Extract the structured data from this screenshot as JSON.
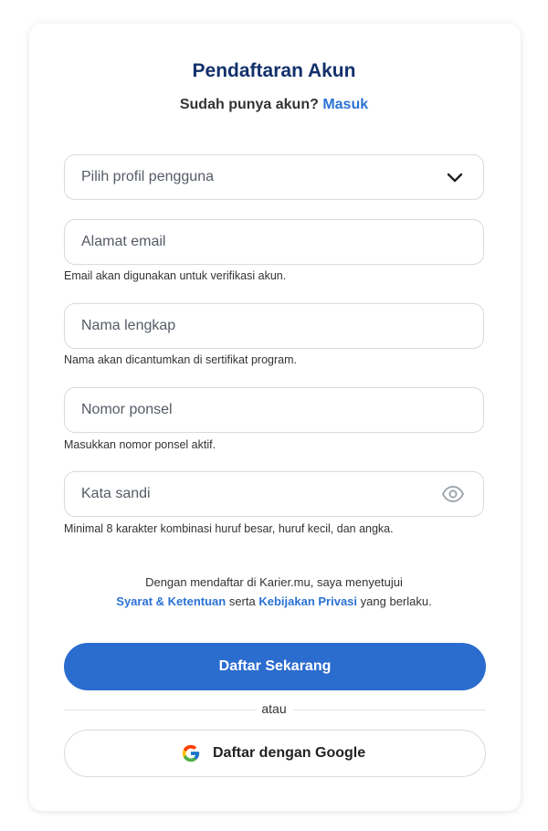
{
  "header": {
    "title": "Pendaftaran Akun",
    "subtitle_prefix": "Sudah punya akun?",
    "login_link": "Masuk"
  },
  "form": {
    "profile_select": {
      "value": "Pilih profil pengguna",
      "icon": "chevron-down-icon"
    },
    "email": {
      "placeholder": "Alamat email",
      "value": "",
      "hint": "Email akan digunakan untuk verifikasi akun."
    },
    "name": {
      "placeholder": "Nama lengkap",
      "value": "",
      "hint": "Nama akan dicantumkan di sertifikat program."
    },
    "phone": {
      "placeholder": "Nomor ponsel",
      "value": "",
      "hint": "Masukkan nomor ponsel aktif."
    },
    "password": {
      "placeholder": "Kata sandi",
      "value": "",
      "hint": "Minimal 8 karakter kombinasi huruf besar, huruf kecil, dan angka.",
      "icon": "eye-icon"
    }
  },
  "terms": {
    "line1": "Dengan mendaftar di Karier.mu, saya menyetujui",
    "terms_link": "Syarat & Ketentuan",
    "conjunction": "serta",
    "privacy_link": "Kebijakan Privasi",
    "suffix": "yang berlaku."
  },
  "actions": {
    "submit_label": "Daftar Sekarang",
    "divider_text": "atau",
    "google_label": "Daftar dengan Google"
  },
  "colors": {
    "title": "#12306b",
    "accent": "#2b72d4",
    "primary_button": "#2b6ccf",
    "border": "#d7dae0"
  }
}
